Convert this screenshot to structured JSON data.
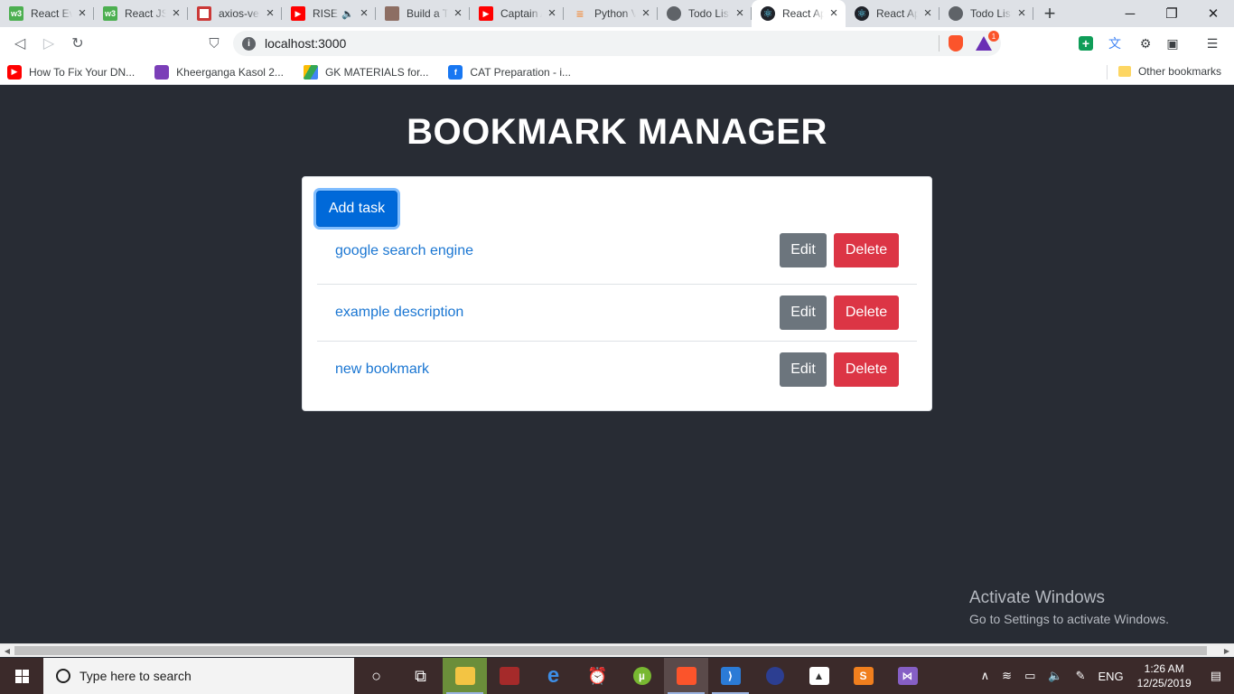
{
  "browser": {
    "tabs": [
      {
        "title": "React Eve",
        "icon": "w3schools-icon",
        "active": false
      },
      {
        "title": "React JSX",
        "icon": "w3schools-icon",
        "active": false
      },
      {
        "title": "axios-ver",
        "icon": "npm-icon",
        "active": false
      },
      {
        "title": "RISE",
        "icon": "youtube-icon",
        "active": false,
        "audio": "speaker-icon"
      },
      {
        "title": "Build a To",
        "icon": "robot-icon",
        "active": false
      },
      {
        "title": "Captain A",
        "icon": "youtube-icon",
        "active": false
      },
      {
        "title": "Python V",
        "icon": "stackoverflow-icon",
        "active": false
      },
      {
        "title": "Todo List",
        "icon": "globe-icon",
        "active": false
      },
      {
        "title": "React Ap",
        "icon": "react-icon",
        "active": true
      },
      {
        "title": "React Ap",
        "icon": "react-icon",
        "active": false
      },
      {
        "title": "Todo List",
        "icon": "globe-icon",
        "active": false
      }
    ],
    "url": "localhost:3000",
    "rewards_badge": "1",
    "bookmarks": [
      {
        "label": "How To Fix Your DN...",
        "icon": "youtube-icon"
      },
      {
        "label": "Kheerganga Kasol 2...",
        "icon": "tripoto-icon"
      },
      {
        "label": "GK MATERIALS for...",
        "icon": "google-drive-icon"
      },
      {
        "label": "CAT Preparation - i...",
        "icon": "facebook-icon"
      }
    ],
    "other_bookmarks": "Other bookmarks"
  },
  "app": {
    "title": "BOOKMARK MANAGER",
    "add_button": "Add task",
    "items": [
      {
        "label": "google search engine",
        "edit": "Edit",
        "delete": "Delete"
      },
      {
        "label": "example description",
        "edit": "Edit",
        "delete": "Delete"
      },
      {
        "label": "new bookmark",
        "edit": "Edit",
        "delete": "Delete"
      }
    ],
    "colors": {
      "background": "#282c34",
      "primary": "#0069d9",
      "secondary": "#6c757d",
      "danger": "#dc3545",
      "link": "#1a76d2"
    }
  },
  "watermark": {
    "line1": "Activate Windows",
    "line2": "Go to Settings to activate Windows."
  },
  "taskbar": {
    "search_placeholder": "Type here to search",
    "language": "ENG",
    "time": "1:26 AM",
    "date": "12/25/2019"
  }
}
